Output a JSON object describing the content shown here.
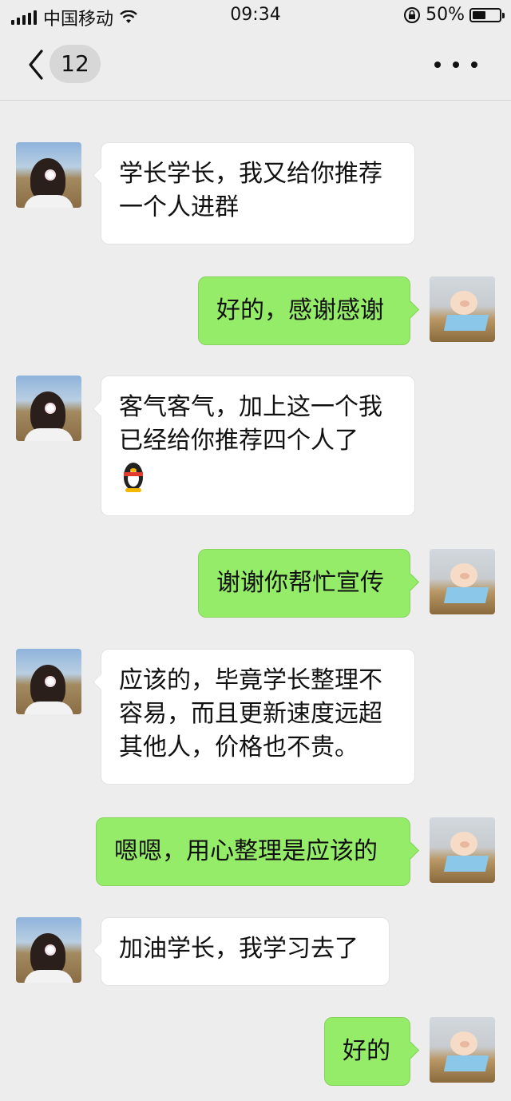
{
  "status_bar": {
    "carrier": "中国移动",
    "time": "09:34",
    "battery": "50%",
    "battery_level": 0.5
  },
  "nav": {
    "unread_count": "12"
  },
  "messages": [
    {
      "side": "in",
      "text": "学长学长，我又给你推荐\n一个人进群"
    },
    {
      "side": "out",
      "text": "好的，感谢感谢"
    },
    {
      "side": "in",
      "text": "客气客气，加上这一个我\n已经给你推荐四个人了",
      "emoji": "penguin"
    },
    {
      "side": "out",
      "text": "谢谢你帮忙宣传"
    },
    {
      "side": "in",
      "text": "应该的，毕竟学长整理不\n容易，而且更新速度远超\n其他人，价格也不贵。"
    },
    {
      "side": "out",
      "text": "嗯嗯，用心整理是应该的"
    },
    {
      "side": "in",
      "text": "加油学长，我学习去了"
    },
    {
      "side": "out",
      "text": "好的"
    }
  ]
}
